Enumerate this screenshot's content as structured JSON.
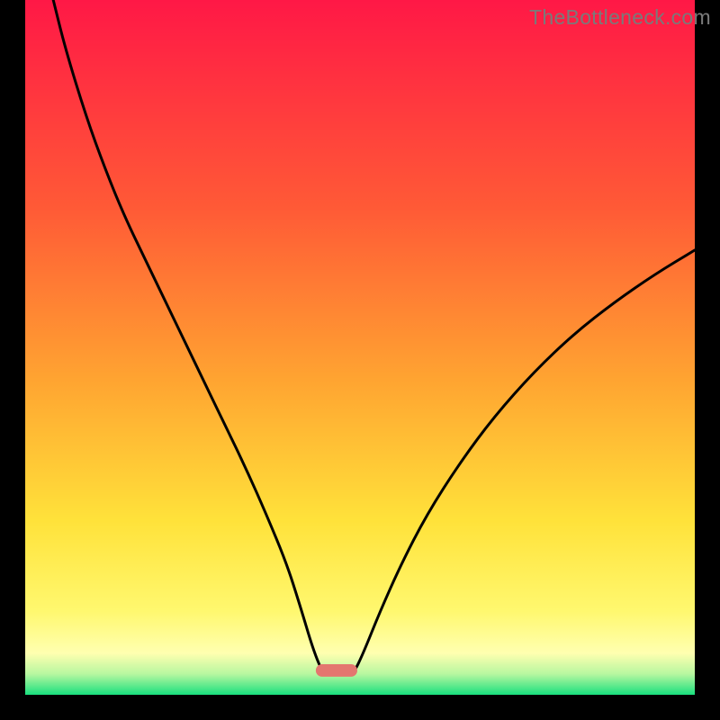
{
  "watermark": "TheBottleneck.com",
  "chart_data": {
    "type": "line",
    "title": "",
    "xlabel": "",
    "ylabel": "",
    "xlim": [
      0,
      100
    ],
    "ylim": [
      0,
      100
    ],
    "background": {
      "gradient_stops": [
        {
          "offset": 0,
          "color": "#ff1846"
        },
        {
          "offset": 0.3,
          "color": "#ff5a36"
        },
        {
          "offset": 0.55,
          "color": "#ffa531"
        },
        {
          "offset": 0.75,
          "color": "#ffe23a"
        },
        {
          "offset": 0.88,
          "color": "#fff86f"
        },
        {
          "offset": 0.94,
          "color": "#ffffb0"
        },
        {
          "offset": 0.97,
          "color": "#b7f7a0"
        },
        {
          "offset": 1.0,
          "color": "#19e07e"
        }
      ]
    },
    "frame_color": "#000000",
    "frame_thickness": 2,
    "minimum_marker": {
      "x_fraction": 0.465,
      "y_fraction": 0.965,
      "width_fraction": 0.062,
      "height_fraction": 0.018,
      "rx": 7,
      "fill": "#e4766f"
    },
    "series": [
      {
        "name": "curve-left",
        "stroke": "#000000",
        "stroke_width": 3,
        "points": [
          {
            "x": 4.2,
            "y": 100.0
          },
          {
            "x": 6.0,
            "y": 93.0
          },
          {
            "x": 9.0,
            "y": 83.5
          },
          {
            "x": 12.0,
            "y": 75.5
          },
          {
            "x": 15.0,
            "y": 68.5
          },
          {
            "x": 18.0,
            "y": 62.5
          },
          {
            "x": 21.0,
            "y": 56.5
          },
          {
            "x": 24.0,
            "y": 50.5
          },
          {
            "x": 27.0,
            "y": 44.5
          },
          {
            "x": 30.0,
            "y": 38.5
          },
          {
            "x": 33.0,
            "y": 32.5
          },
          {
            "x": 36.0,
            "y": 26.0
          },
          {
            "x": 39.0,
            "y": 19.0
          },
          {
            "x": 41.0,
            "y": 13.0
          },
          {
            "x": 43.0,
            "y": 6.5
          },
          {
            "x": 44.5,
            "y": 3.0
          },
          {
            "x": 45.5,
            "y": 3.0
          }
        ]
      },
      {
        "name": "curve-right",
        "stroke": "#000000",
        "stroke_width": 3,
        "points": [
          {
            "x": 48.0,
            "y": 3.0
          },
          {
            "x": 49.0,
            "y": 3.0
          },
          {
            "x": 50.5,
            "y": 6.0
          },
          {
            "x": 53.0,
            "y": 12.0
          },
          {
            "x": 56.0,
            "y": 18.5
          },
          {
            "x": 60.0,
            "y": 26.0
          },
          {
            "x": 65.0,
            "y": 33.5
          },
          {
            "x": 70.0,
            "y": 40.0
          },
          {
            "x": 76.0,
            "y": 46.5
          },
          {
            "x": 82.0,
            "y": 52.0
          },
          {
            "x": 88.0,
            "y": 56.5
          },
          {
            "x": 94.0,
            "y": 60.5
          },
          {
            "x": 100.0,
            "y": 64.0
          }
        ]
      }
    ]
  }
}
